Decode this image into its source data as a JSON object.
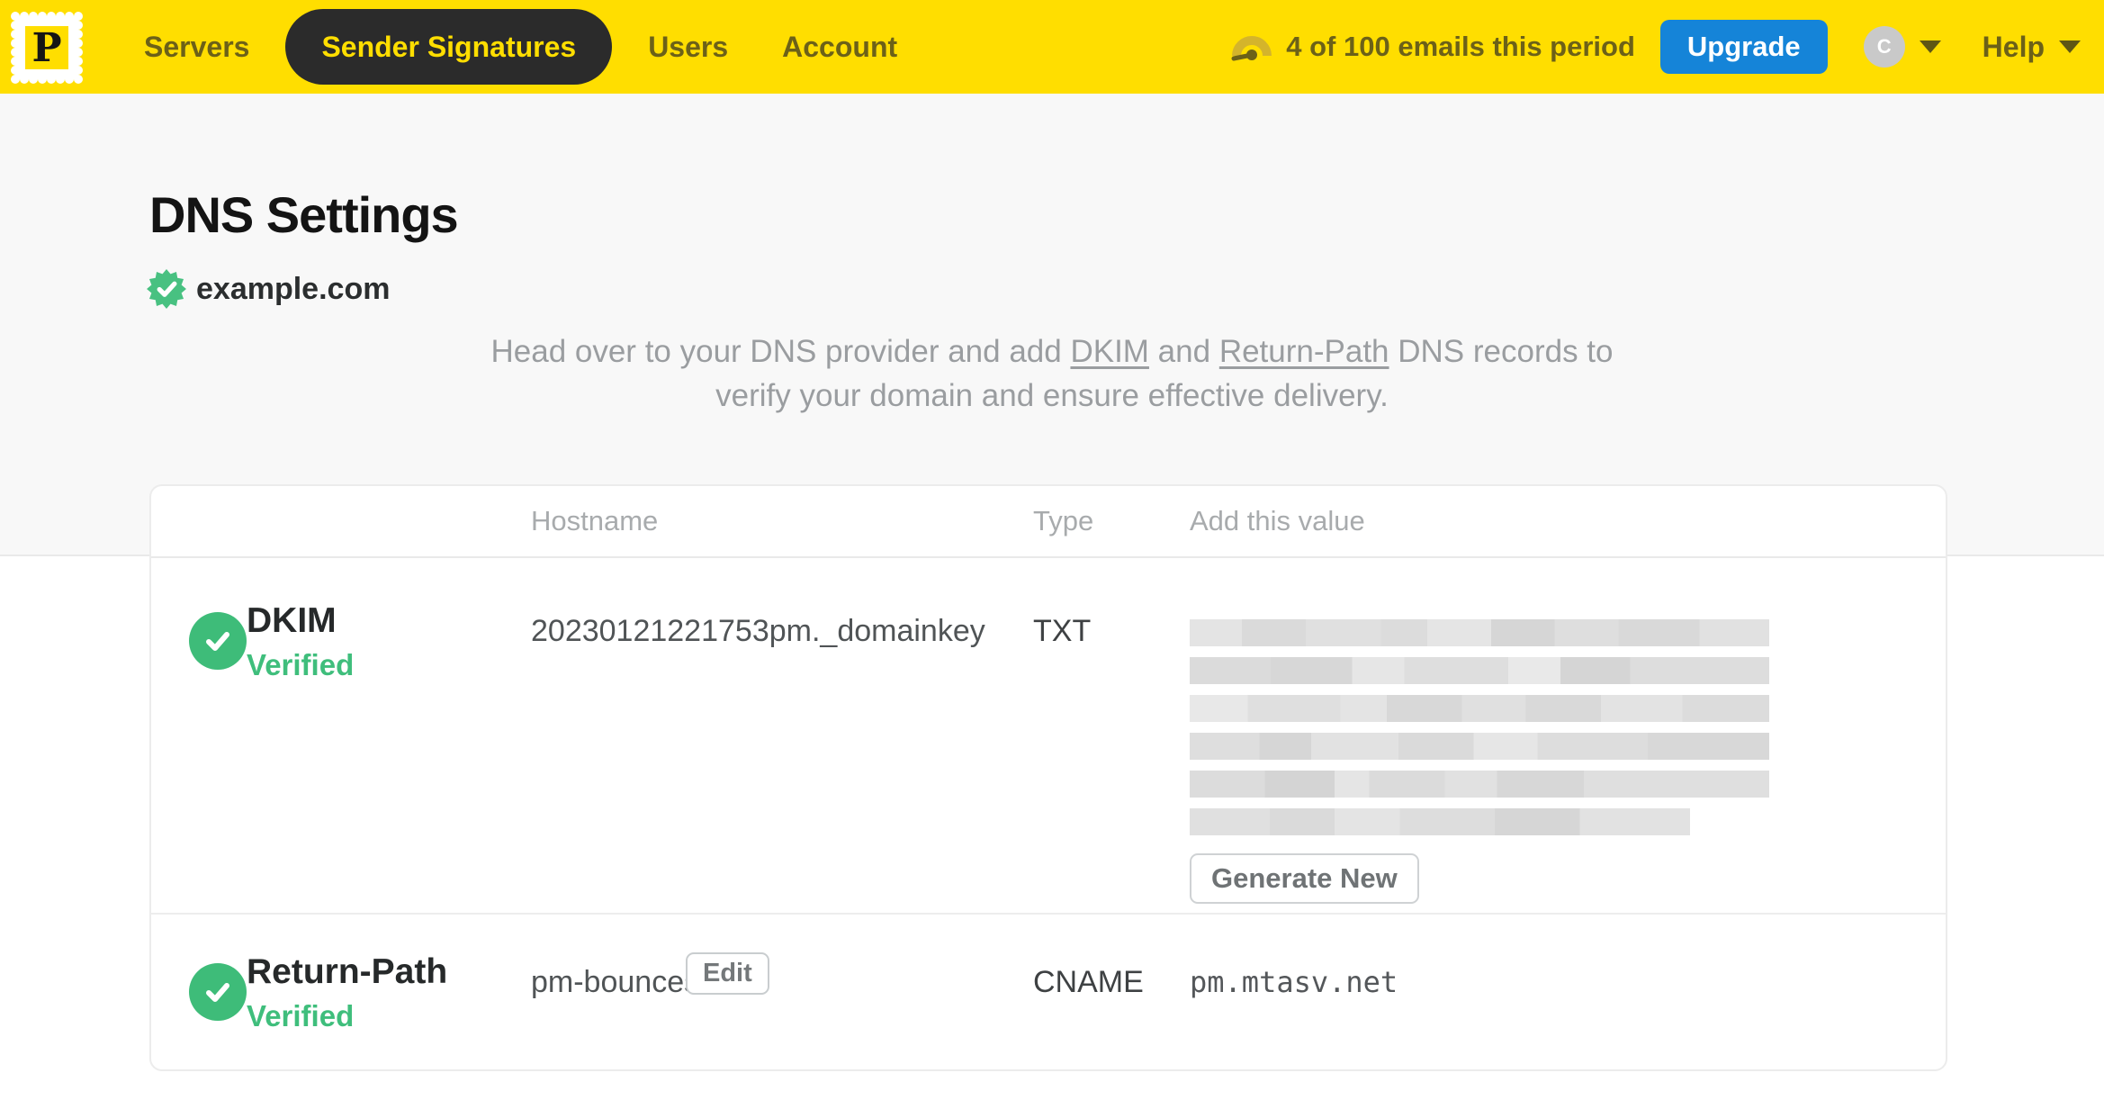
{
  "nav": {
    "logo_letter": "P",
    "items": [
      {
        "label": "Servers",
        "active": false
      },
      {
        "label": "Sender Signatures",
        "active": true
      },
      {
        "label": "Users",
        "active": false
      },
      {
        "label": "Account",
        "active": false
      }
    ],
    "usage_text": "4 of 100 emails this period",
    "upgrade_label": "Upgrade",
    "avatar_initial": "C",
    "help_label": "Help"
  },
  "page": {
    "title": "DNS Settings",
    "domain": "example.com",
    "intro": {
      "part1": "Head over to your DNS provider and add ",
      "dkim_link": "DKIM",
      "part2": " and ",
      "return_path_link": "Return-Path",
      "part3": " DNS records to verify your domain and ensure effective delivery."
    }
  },
  "table": {
    "headers": {
      "hostname": "Hostname",
      "type": "Type",
      "value": "Add this value"
    },
    "rows": [
      {
        "name": "DKIM",
        "status": "Verified",
        "hostname": "20230121221753pm._domainkey",
        "type": "TXT",
        "value_redacted": true,
        "value_rows": 6,
        "action": "Generate New"
      },
      {
        "name": "Return-Path",
        "status": "Verified",
        "hostname": "pm-bounces",
        "hostname_action": "Edit",
        "type": "CNAME",
        "value": "pm.mtasv.net"
      }
    ]
  },
  "colors": {
    "brand_yellow": "#ffde00",
    "nav_text_olive": "#6c6118",
    "active_pill_bg": "#2b2b2b",
    "upgrade_blue": "#1584d8",
    "verified_green": "#3ebc79",
    "page_bg_top": "#f8f8f8"
  }
}
